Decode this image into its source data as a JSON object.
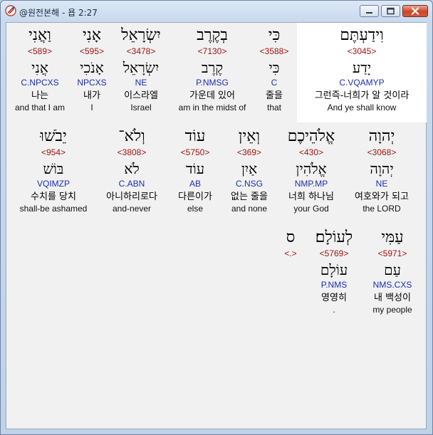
{
  "window": {
    "title": "@원전본해 - 욥 2:27"
  },
  "rows": [
    [
      {
        "heb": "וִידַעְתֶּם",
        "num": "<3045>",
        "lemma": "יָדַע",
        "parse": "C.VQAMYP",
        "kor": "그런즉-너희가 알 것이라",
        "eng": "And ye shall know"
      },
      {
        "heb": "כִּי",
        "num": "<3588>",
        "lemma": "כִּי",
        "parse": "C",
        "kor": "줄을",
        "eng": "that"
      },
      {
        "heb": "בְקֶרֶב",
        "num": "<7130>",
        "lemma": "קֶרֶב",
        "parse": "P.NMSG",
        "kor": "가운데 있어",
        "eng": "am in the midst of"
      },
      {
        "heb": "יִשְׂרָאֵל",
        "num": "<3478>",
        "lemma": "יִשְׂרָאֵל",
        "parse": "NE",
        "kor": "이스라엘",
        "eng": "Israel"
      },
      {
        "heb": "אָנִי",
        "num": "<595>",
        "lemma": "אָנֹכִי",
        "parse": "NPCXS",
        "kor": "내가",
        "eng": "I"
      },
      {
        "heb": "וַאֲנִי",
        "num": "<589>",
        "lemma": "אֲנִי",
        "parse": "C.NPCXS",
        "kor": "나는",
        "eng": "and that I am"
      }
    ],
    [
      {
        "heb": "יְהוָה",
        "num": "<3068>",
        "lemma": "יְהוָה",
        "parse": "NE",
        "kor": "여호와가 되고",
        "eng": "the LORD"
      },
      {
        "heb": "אֱלֹהֵיכֶם",
        "num": "<430>",
        "lemma": "אֱלֹהִין",
        "parse": "NMP.MP",
        "kor": "너희 하나님",
        "eng": "your God"
      },
      {
        "heb": "וְאֵין",
        "num": "<369>",
        "lemma": "אַיִן",
        "parse": "C.NSG",
        "kor": "없는 줄을",
        "eng": "and none"
      },
      {
        "heb": "עוֹד",
        "num": "<5750>",
        "lemma": "עוֹד",
        "parse": "AB",
        "kor": "다른이가",
        "eng": "else"
      },
      {
        "heb": "וְלֹא־",
        "num": "<3808>",
        "lemma": "לֹא",
        "parse": "C.ABN",
        "kor": "아니하리로다",
        "eng": "and-never"
      },
      {
        "heb": "יֵבֹשׁוּ",
        "num": "<954>",
        "lemma": "בּוֹשׁ",
        "parse": "VQIMZP",
        "kor": "수치를 당치",
        "eng": "shall-be ashamed"
      }
    ],
    [
      {
        "heb": "עַמִּי",
        "num": "<5971>",
        "lemma": "עַם",
        "parse": "NMS.CXS",
        "kor": "내 백성이",
        "eng": "my people"
      },
      {
        "heb": "לְעוֹלָם׃",
        "num": "<5769>",
        "lemma": "עוֹלָם",
        "parse": "P.NMS",
        "kor": "영영히",
        "eng": "."
      },
      {
        "heb": "ס",
        "num": "<.>",
        "lemma": "",
        "parse": "",
        "kor": "",
        "eng": ""
      }
    ]
  ]
}
